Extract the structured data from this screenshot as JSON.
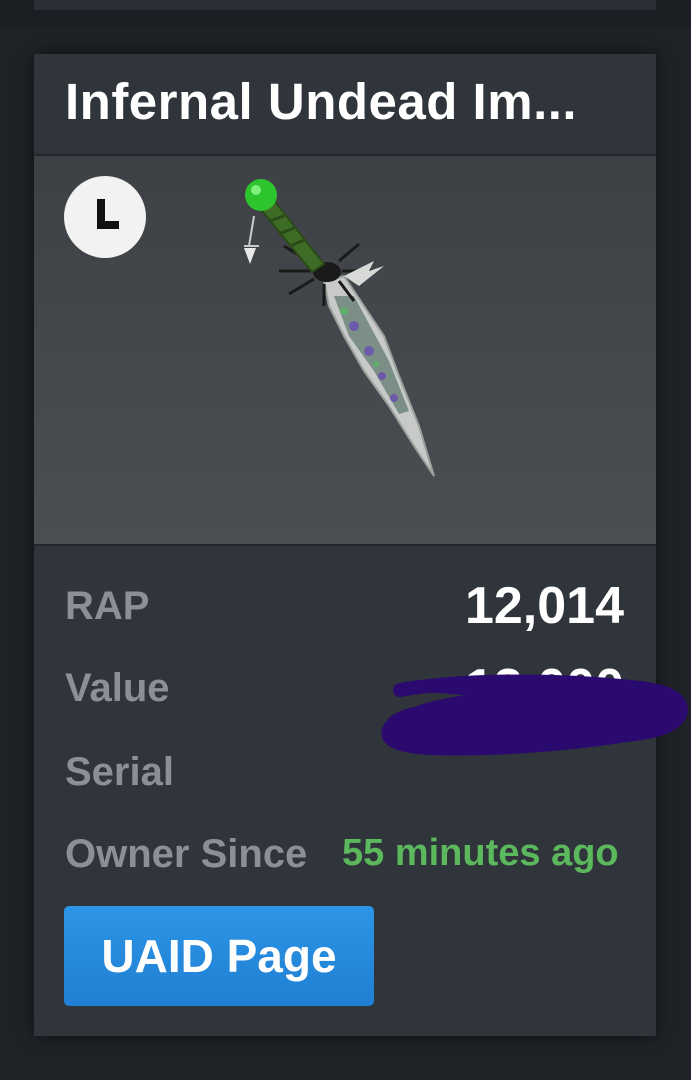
{
  "item": {
    "name": "Infernal Undead Im...",
    "badge_icon": "limited-clock-icon"
  },
  "stats": {
    "rap_label": "RAP",
    "rap_value": "12,014",
    "value_label": "Value",
    "value_value": "13,000",
    "serial_label": "Serial",
    "owner_since_label": "Owner Since",
    "owner_since_value": "55 minutes ago"
  },
  "actions": {
    "uaid_page_label": "UAID Page"
  },
  "colors": {
    "card_bg": "#30343b",
    "label_gray": "#8b8f98",
    "accent_green": "#5cb85c",
    "button_blue": "#2d95e6",
    "redaction_purple": "#2a0a6e"
  }
}
